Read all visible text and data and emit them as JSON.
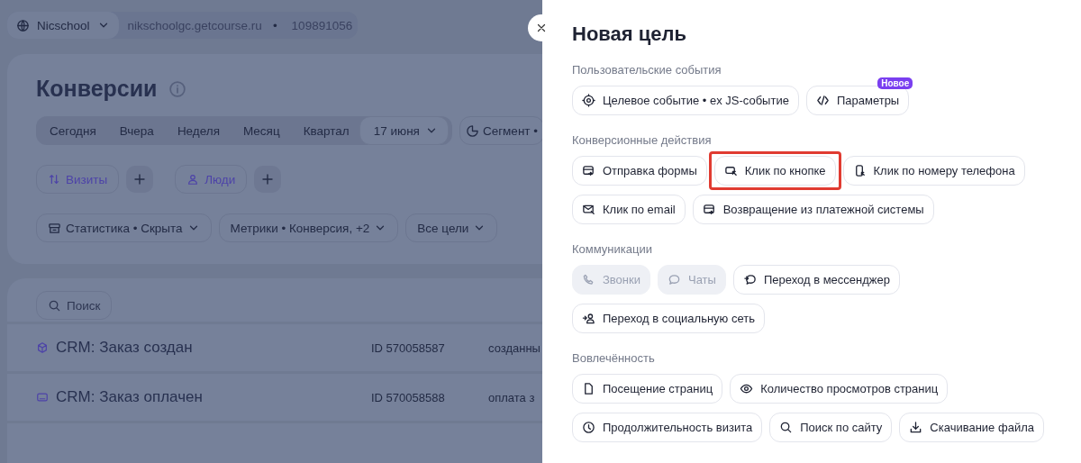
{
  "top_bar": {
    "account": "Nicschool",
    "domain": "nikschoolgc.getcourse.ru",
    "separator": "•",
    "counter_id": "109891056"
  },
  "page": {
    "title": "Конверсии",
    "periods": [
      {
        "label": "Сегодня",
        "kind": "period",
        "selected": false
      },
      {
        "label": "Вчера",
        "kind": "period",
        "selected": false
      },
      {
        "label": "Неделя",
        "kind": "period",
        "selected": false
      },
      {
        "label": "Месяц",
        "kind": "period",
        "selected": false
      },
      {
        "label": "Квартал",
        "kind": "period",
        "selected": false
      },
      {
        "label": "17 июня",
        "kind": "date",
        "selected": true
      }
    ],
    "segment": "Сегмент •",
    "groupings": [
      {
        "label": "Визиты"
      },
      {
        "label": "Люди"
      }
    ],
    "filters": [
      {
        "label": "Статистика • Скрыта"
      },
      {
        "label": "Метрики • Конверсия, +2"
      },
      {
        "label": "Все цели"
      }
    ],
    "search": {
      "placeholder": "Поиск"
    },
    "goals": [
      {
        "name": "CRM: Заказ создан",
        "id": "ID 570058587",
        "column_3": "созданны"
      },
      {
        "name": "CRM: Заказ оплачен",
        "id": "ID 570058588",
        "column_3": "оплата з"
      }
    ]
  },
  "panel": {
    "title": "Новая цель",
    "sections": [
      {
        "title": "Пользовательские события",
        "items": [
          {
            "label": "Целевое событие • ex JS-событие",
            "disabled": false,
            "highlighted": false
          },
          {
            "label": "Параметры",
            "badge": "Новое",
            "disabled": false,
            "highlighted": false
          }
        ]
      },
      {
        "title": "Конверсионные действия",
        "items": [
          {
            "label": "Отправка формы",
            "disabled": false,
            "highlighted": false
          },
          {
            "label": "Клик по кнопке",
            "disabled": false,
            "highlighted": true
          },
          {
            "label": "Клик по номеру телефона",
            "disabled": false,
            "highlighted": false
          },
          {
            "label": "Клик по email",
            "disabled": false,
            "highlighted": false
          },
          {
            "label": "Возвращение из платежной системы",
            "disabled": false,
            "highlighted": false
          }
        ]
      },
      {
        "title": "Коммуникации",
        "items": [
          {
            "label": "Звонки",
            "disabled": true,
            "highlighted": false
          },
          {
            "label": "Чаты",
            "disabled": true,
            "highlighted": false
          },
          {
            "label": "Переход в мессенджер",
            "disabled": false,
            "highlighted": false
          },
          {
            "label": "Переход в социальную сеть",
            "disabled": false,
            "highlighted": false
          }
        ]
      },
      {
        "title": "Вовлечённость",
        "items": [
          {
            "label": "Посещение страниц",
            "disabled": false,
            "highlighted": false
          },
          {
            "label": "Количество просмотров страниц",
            "disabled": false,
            "highlighted": false
          },
          {
            "label": "Продолжительность визита",
            "disabled": false,
            "highlighted": false
          },
          {
            "label": "Поиск по сайту",
            "disabled": false,
            "highlighted": false
          },
          {
            "label": "Скачивание файла",
            "disabled": false,
            "highlighted": false
          }
        ]
      }
    ]
  }
}
